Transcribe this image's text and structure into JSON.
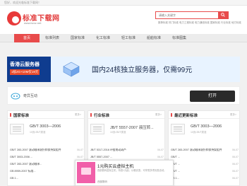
{
  "topbar": {
    "welcome": "您好，欢迎光临标准下载网！"
  },
  "logo": {
    "name": "标准下载网",
    "url": "www.bzxz.net"
  },
  "search": {
    "placeholder": "请输入关键字"
  },
  "hot_links": "推荐标准 热门标准 电力工程标准 电力通信标准 国家标准 行业标准 地方标准",
  "nav": {
    "items": [
      "首页",
      "标准列表",
      "国家标准",
      "化工标准",
      "轻工标准",
      "船舶标准",
      "标准图集"
    ],
    "active_index": 0
  },
  "ad_banner": {
    "left_title": "香港云服务器",
    "left_price": "1核2G+10M仅19元",
    "headline": "国内24核独立服务器，仅需99元"
  },
  "app_ad": {
    "name": "奇异互动",
    "open_label": "打开"
  },
  "columns": [
    {
      "title": "国家标准",
      "more": "更多>",
      "featured": {
        "title": "GB/T 3003—2006",
        "sub": "10页/JB/T类准"
      },
      "rows": [
        {
          "text": "GB/T 283-2007 滚动轴承滚针和保持架组件",
          "date": "06-07"
        },
        {
          "text": "GB/T 3003-2006 ...",
          "date": "06-07"
        },
        {
          "text": "GB/T 283-2007 滚动轴承...",
          "date": "06-07"
        },
        {
          "text": "GB 8959-2007 标准...",
          "date": "06-07"
        },
        {
          "text": "GB 1...",
          "date": "06-07"
        }
      ]
    },
    {
      "title": "行业标准",
      "more": "更多>",
      "featured": {
        "title": "JB/T 5557-2007 液压转...",
        "sub": "10页/JB/T类准"
      },
      "rows": [
        {
          "text": "JB/T 5317-2016 环链电动葫芦",
          "date": "06-07"
        },
        {
          "text": "JB/T 5557-2007 ...",
          "date": "06-07"
        },
        {
          "text": "JB/T ...",
          "date": "06-07"
        },
        {
          "text": "JB/T ...",
          "date": "06-07"
        },
        {
          "text": "JB/T ...",
          "date": "06-07"
        }
      ]
    },
    {
      "title": "最近更新标准",
      "more": "更多>",
      "featured": {
        "title": "GB/T 3003—2006",
        "sub": "10页/JB/T类准"
      },
      "rows": [
        {
          "text": "GB/T 283-2007 滚动轴承滚针和保持架组件",
          "date": "06-07"
        },
        {
          "text": "GB/T ...",
          "date": "06-07"
        },
        {
          "text": "GB/T ...",
          "date": "06-07"
        },
        {
          "text": "GB/T ...",
          "date": "06-07"
        },
        {
          "text": "GB 1...",
          "date": "06-07"
        }
      ]
    }
  ],
  "popup_ad": {
    "title": "1元购买云虚拟主机",
    "desc": "西部数码虚拟主机，特惠1元起，价格实惠，可享受多项优惠活动。",
    "brand": "西部数码"
  },
  "colors": {
    "accent": "#e84b4b",
    "ad_blue": "#0f3c8f",
    "popup_pink": "#f15fa9"
  }
}
